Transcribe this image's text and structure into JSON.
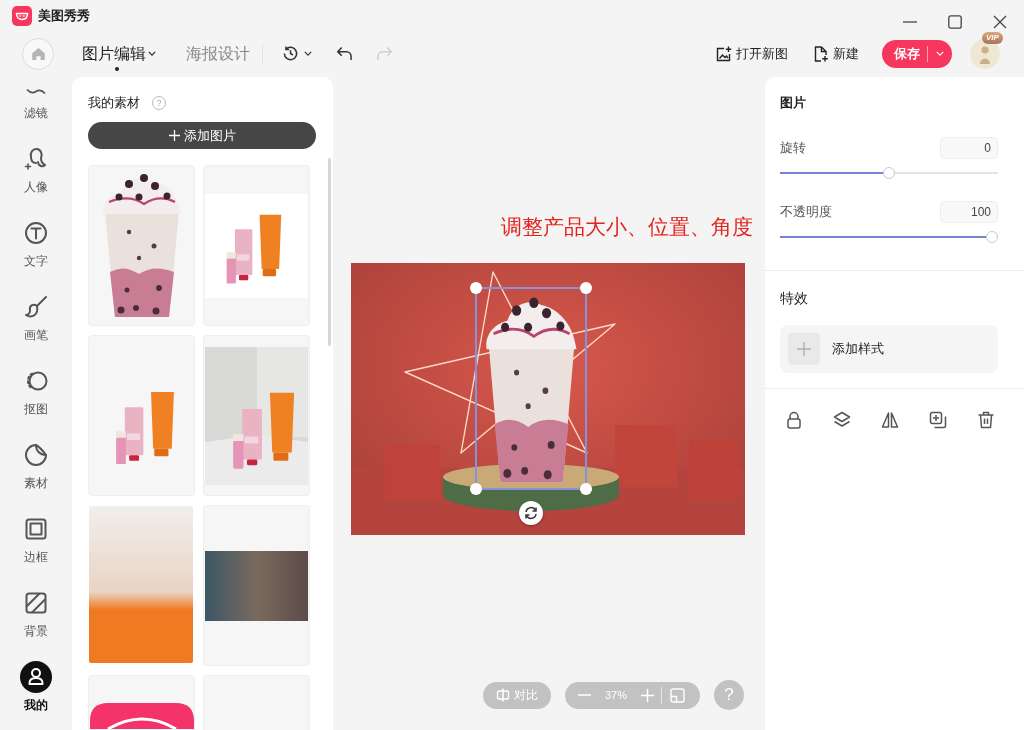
{
  "app": {
    "title": "美图秀秀"
  },
  "toolbar": {
    "tabs": [
      {
        "label": "图片编辑",
        "selected": true
      },
      {
        "label": "海报设计",
        "selected": false
      }
    ],
    "undo": {
      "disabled": false
    },
    "redo": {
      "disabled": true
    },
    "actions": [
      {
        "label": "打开新图"
      },
      {
        "label": "新建"
      }
    ],
    "save": {
      "label": "保存"
    },
    "avatar": {
      "badge": "VIP"
    }
  },
  "nav": [
    {
      "label": "滤镜",
      "selected": false
    },
    {
      "label": "人像",
      "selected": false
    },
    {
      "label": "文字",
      "selected": false
    },
    {
      "label": "画笔",
      "selected": false
    },
    {
      "label": "抠图",
      "selected": false
    },
    {
      "label": "素材",
      "selected": false
    },
    {
      "label": "边框",
      "selected": false
    },
    {
      "label": "背景",
      "selected": false
    },
    {
      "label": "我的",
      "selected": true
    }
  ],
  "materials": {
    "title": "我的素材",
    "help": "?",
    "add_label": "添加图片",
    "tiles": [
      {
        "kind": "cup"
      },
      {
        "kind": "tubes-white"
      },
      {
        "kind": "tubes"
      },
      {
        "kind": "tubes-room"
      },
      {
        "kind": "portrait"
      },
      {
        "kind": "photo"
      },
      {
        "kind": "app-logo"
      },
      {
        "kind": "blank"
      }
    ]
  },
  "canvas": {
    "annotation": "调整产品大小、位置、角度"
  },
  "view_controls": {
    "compare": "对比",
    "zoom": "37%",
    "help": "?"
  },
  "properties": {
    "title": "图片",
    "sliders": [
      {
        "label": "旋转",
        "value": "0",
        "level": 0.5
      },
      {
        "label": "不透明度",
        "value": "100",
        "level": 1
      }
    ],
    "effects": {
      "title": "特效",
      "add_label": "添加样式"
    }
  }
}
